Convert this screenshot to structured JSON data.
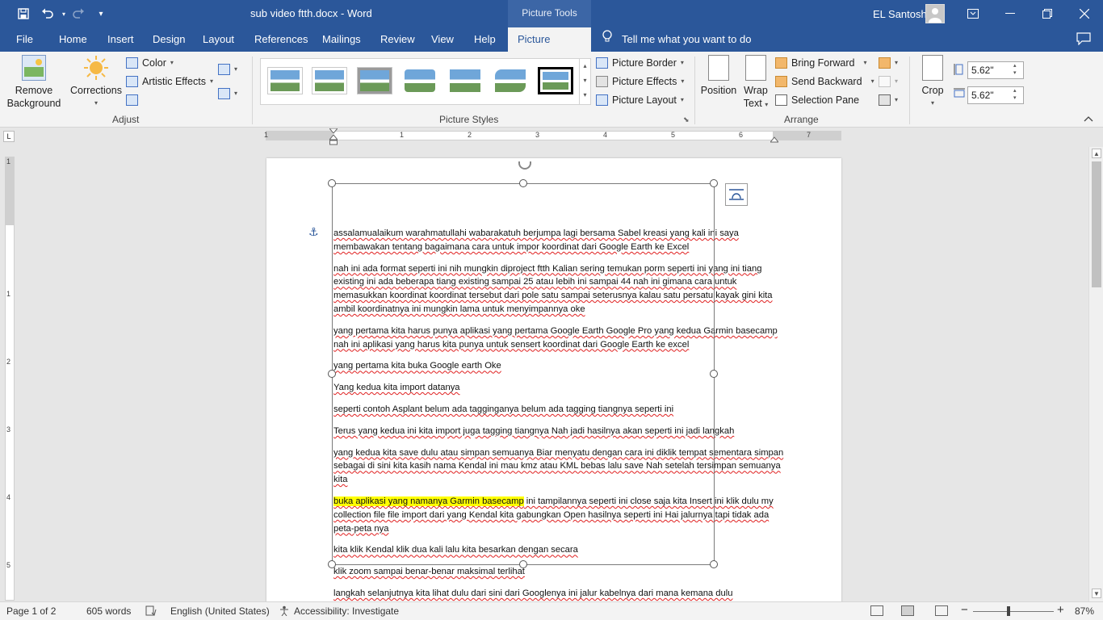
{
  "app": {
    "doc_title": "sub video ftth.docx  -  Word",
    "context_tab_group": "Picture Tools",
    "user": "EL Santosh"
  },
  "quick_access": {
    "save": "save-icon",
    "undo": "undo-icon",
    "redo": "redo-icon",
    "customize": "customize-qat-icon"
  },
  "window_controls": [
    "ribbon-display-icon",
    "minimize-icon",
    "restore-icon",
    "close-icon"
  ],
  "tabs": [
    "File",
    "Home",
    "Insert",
    "Design",
    "Layout",
    "References",
    "Mailings",
    "Review",
    "View",
    "Help",
    "Picture Format"
  ],
  "active_tab": "Picture Format",
  "tell_me": "Tell me what you want to do",
  "ribbon": {
    "adjust": {
      "label": "Adjust",
      "remove_bg": "Remove Background",
      "corrections": "Corrections",
      "color": "Color",
      "artistic": "Artistic Effects"
    },
    "styles": {
      "label": "Picture Styles",
      "border": "Picture Border",
      "effects": "Picture Effects",
      "layout": "Picture Layout"
    },
    "arrange": {
      "label": "Arrange",
      "position": "Position",
      "wrap": "Wrap Text",
      "bring_forward": "Bring Forward",
      "send_backward": "Send Backward",
      "selection_pane": "Selection Pane"
    },
    "size": {
      "crop": "Crop",
      "height": "5.62\"",
      "width": "5.62\""
    }
  },
  "ruler": {
    "h_numbers": [
      "1",
      "1",
      "2",
      "3",
      "4",
      "5",
      "6",
      "7"
    ],
    "v_numbers": [
      "1",
      "1",
      "2",
      "3",
      "4",
      "5"
    ]
  },
  "document": {
    "paragraphs": [
      "assalamualaikum warahmatullahi wabarakatuh  berjumpa lagi bersama Sabel kreasi yang   kali ini saya membawakan tentang bagaimana cara  untuk impor koordinat dari Google Earth ke Excel",
      "nah ini ada format seperti ini nih mungkin  diproject ftth Kalian sering temukan porm   seperti ini yang ini tiang existing  ini ada beberapa tiang existing sampai   25 atau lebih ini sampai 44 nah ini gimana  cara untuk memasukkan koordinat koordinat   tersebut dari pole satu sampai  seterusnya kalau satu persatu kayak gini kita ambil koordinatnya  ini mungkin lama untuk menyimpannya oke",
      "yang pertama kita harus punya aplikasi  yang pertama Google Earth Google Pro   yang kedua Garmin basecamp nah ini  aplikasi yang harus kita punya untuk sensert koordinat dari Google Earth ke excel",
      "yang pertama kita buka Google earth Oke",
      " Yang kedua kita import datanya",
      "seperti contoh Asplant belum ada tagginganya belum ada tagging tiangnya seperti ini",
      "Terus yang kedua ini kita  import juga tagging tiangnya Nah jadi hasilnya akan seperti ini jadi langkah",
      "yang kedua kita save  dulu atau simpan semuanya Biar menyatu dengan cara ini diklik tempat sementara simpan sebagai di sini kita kasih nama Kendal ini mau kmz atau KML bebas lalu save Nah setelah tersimpan semuanya kita",
      "",
      " kita klik Kendal klik dua kali  lalu kita besarkan dengan secara",
      "klik zoom sampai benar-benar maksimal terlihat",
      "langkah selanjutnya kita lihat dulu dari sini dari  Googlenya ini jalur kabelnya dari mana kemana dulu"
    ],
    "para9_highlight": "buka aplikasi yang namanya Garmin basecamp",
    "para9_rest": " ini tampilannya seperti ini close saja kita Insert  ini klik dulu my collection file file import dari yang Kendal kita gabungkan Open hasilnya seperti ini Hai jalurnya tapi tidak ada peta-peta nya"
  },
  "statusbar": {
    "page": "Page 1 of 2",
    "words": "605 words",
    "language": "English (United States)",
    "accessibility": "Accessibility: Investigate",
    "zoom": "87%",
    "zoom_level": 0.87
  },
  "colors": {
    "title_bar": "#2b579a",
    "ribbon_bg": "#f3f3f3",
    "highlight": "#ffff00",
    "spell_error": "#e02020"
  }
}
